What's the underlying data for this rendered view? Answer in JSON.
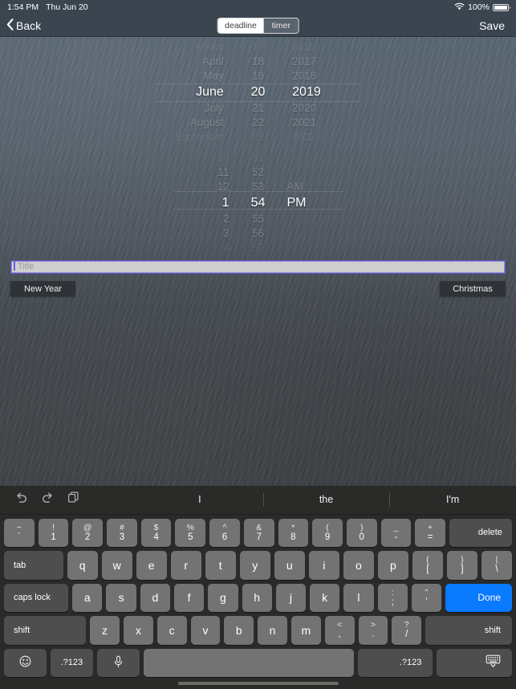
{
  "status_bar": {
    "time": "1:54 PM",
    "date": "Thu Jun 20",
    "wifi_icon": "wifi-icon",
    "battery_percent": "100%",
    "battery_icon": "battery-full-icon"
  },
  "nav_bar": {
    "back_label": "Back",
    "back_icon": "chevron-left-icon",
    "save_label": "Save",
    "segmented": {
      "options": [
        {
          "label": "deadline",
          "selected": true
        },
        {
          "label": "timer",
          "selected": false
        }
      ]
    }
  },
  "date_picker": {
    "months": [
      "March",
      "April",
      "May",
      "June",
      "July",
      "August",
      "September"
    ],
    "days": [
      "17",
      "18",
      "19",
      "20",
      "21",
      "22",
      "23"
    ],
    "years": [
      "2016",
      "2017",
      "2018",
      "2019",
      "2020",
      "2021",
      "2022"
    ],
    "selected_month": "June",
    "selected_day": "20",
    "selected_year": "2019",
    "selected_index": 3
  },
  "time_picker": {
    "hours": [
      "10",
      "11",
      "12",
      "1",
      "2",
      "3",
      "4"
    ],
    "minutes": [
      "51",
      "52",
      "53",
      "54",
      "55",
      "56",
      "57"
    ],
    "meridiem": [
      "",
      "",
      "AM",
      "PM",
      "",
      "",
      ""
    ],
    "selected_hour": "1",
    "selected_minute": "54",
    "selected_meridiem": "PM",
    "selected_index": 3
  },
  "title_field": {
    "placeholder": "Title",
    "value": "",
    "focus_color": "#5b4fb8"
  },
  "quick_buttons": {
    "new_year": "New Year",
    "christmas": "Christmas"
  },
  "keyboard": {
    "predictive": {
      "undo_icon": "undo-icon",
      "redo_icon": "redo-icon",
      "paste_icon": "paste-icon",
      "suggestions": [
        "I",
        "the",
        "I'm"
      ]
    },
    "row_numbers": [
      {
        "top": "~",
        "bot": "`"
      },
      {
        "top": "!",
        "bot": "1"
      },
      {
        "top": "@",
        "bot": "2"
      },
      {
        "top": "#",
        "bot": "3"
      },
      {
        "top": "$",
        "bot": "4"
      },
      {
        "top": "%",
        "bot": "5"
      },
      {
        "top": "^",
        "bot": "6"
      },
      {
        "top": "&",
        "bot": "7"
      },
      {
        "top": "*",
        "bot": "8"
      },
      {
        "top": "(",
        "bot": "9"
      },
      {
        "top": ")",
        "bot": "0"
      },
      {
        "top": "_",
        "bot": "-"
      },
      {
        "top": "+",
        "bot": "="
      }
    ],
    "delete_label": "delete",
    "row_q": {
      "tab_label": "tab",
      "keys": [
        "q",
        "w",
        "e",
        "r",
        "t",
        "y",
        "u",
        "i",
        "o",
        "p"
      ],
      "bracket_open": {
        "top": "{",
        "bot": "["
      },
      "bracket_close": {
        "top": "}",
        "bot": "]"
      },
      "pipe": {
        "top": "|",
        "bot": "\\"
      }
    },
    "row_a": {
      "caps_label": "caps lock",
      "keys": [
        "a",
        "s",
        "d",
        "f",
        "g",
        "h",
        "j",
        "k",
        "l"
      ],
      "semicolon": {
        "top": ":",
        "bot": ";"
      },
      "quote": {
        "top": "”",
        "bot": "’"
      },
      "done_label": "Done",
      "done_color": "#0a7aff"
    },
    "row_z": {
      "shift_left_label": "shift",
      "keys": [
        "z",
        "x",
        "c",
        "v",
        "b",
        "n",
        "m"
      ],
      "comma": {
        "top": "<",
        "bot": ","
      },
      "period": {
        "top": ">",
        "bot": "."
      },
      "slash": {
        "top": "?",
        "bot": "/"
      },
      "shift_right_label": "shift"
    },
    "row_space": {
      "emoji_icon": "emoji-smiley-icon",
      "num_left_label": ".?123",
      "mic_icon": "microphone-icon",
      "space_label": "",
      "num_right_label": ".?123",
      "hide_keyboard_icon": "hide-keyboard-icon"
    }
  }
}
